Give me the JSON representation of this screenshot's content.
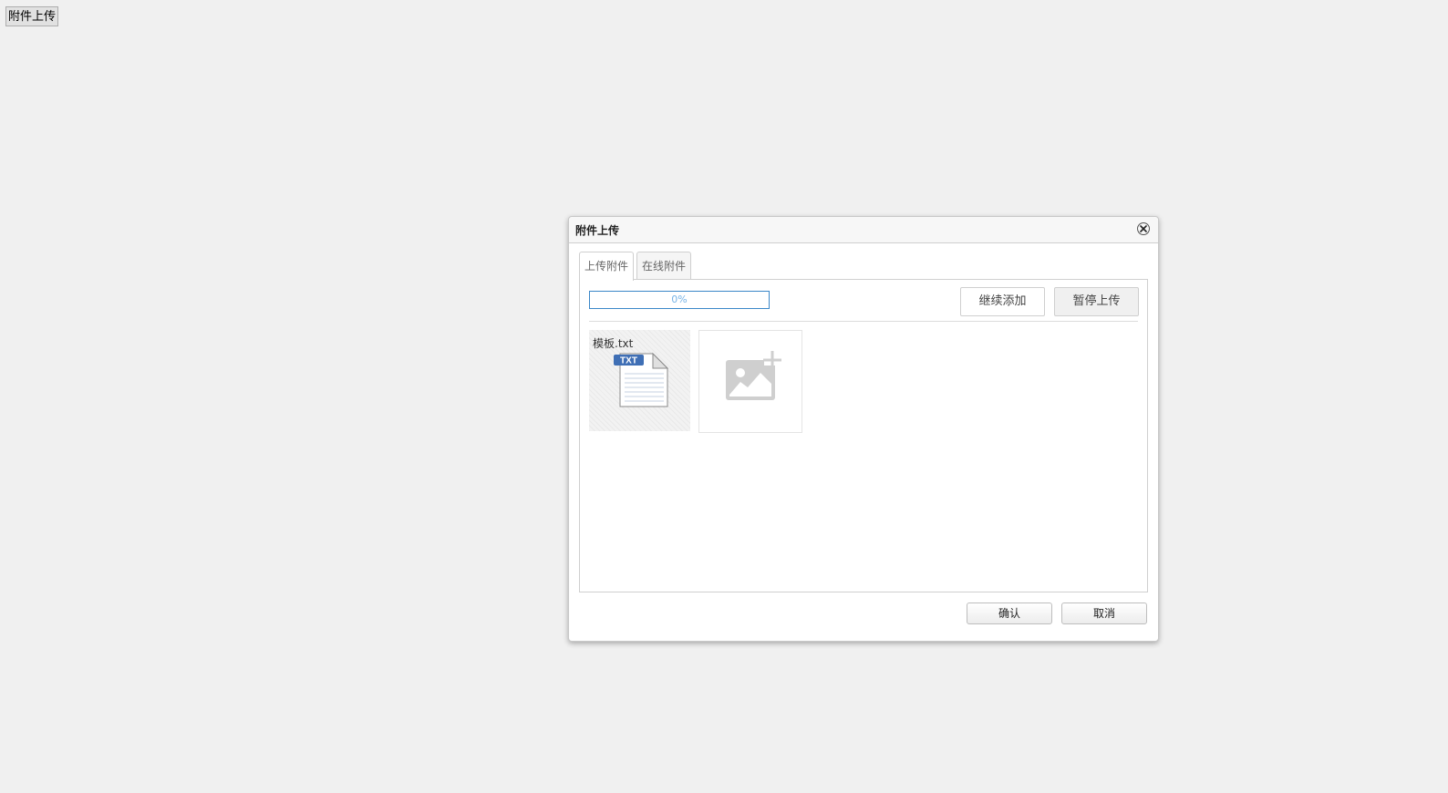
{
  "page": {
    "open_button_label": "附件上传"
  },
  "dialog": {
    "title": "附件上传",
    "close_icon": "close-icon",
    "tabs": [
      {
        "label": "上传附件",
        "active": true
      },
      {
        "label": "在线附件",
        "active": false
      }
    ],
    "upload": {
      "progress_text": "0%",
      "progress_value": 0,
      "continue_add_label": "继续添加",
      "pause_upload_label": "暂停上传",
      "files": [
        {
          "name": "模板.txt",
          "icon": "txt-file-icon",
          "badge": "TXT"
        }
      ],
      "add_more_icon": "add-image-icon"
    },
    "footer": {
      "confirm_label": "确认",
      "cancel_label": "取消"
    }
  },
  "colors": {
    "background": "#f0f0f0",
    "progress_border": "#3a87c8",
    "progress_text": "#76b3e6",
    "txt_badge": "#3f6fb5"
  }
}
